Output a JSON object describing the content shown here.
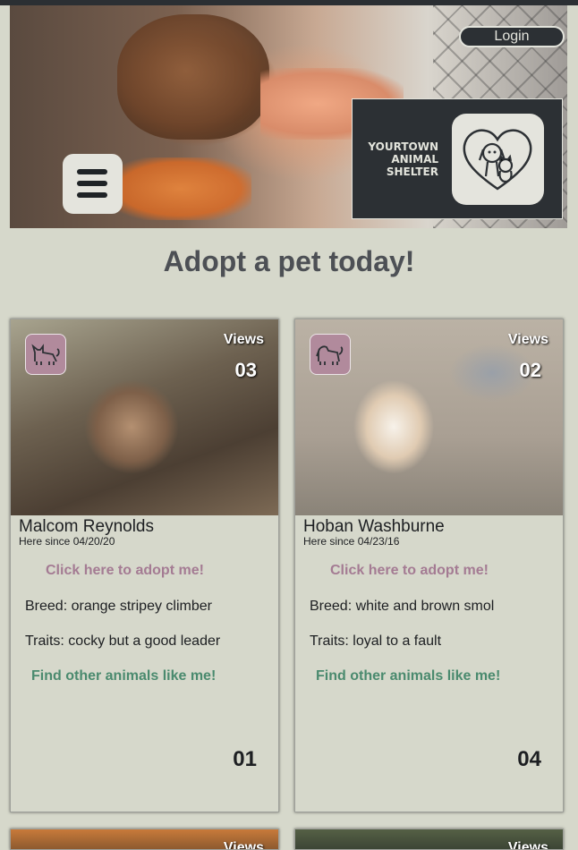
{
  "header": {
    "login_label": "Login",
    "brand_lines": [
      "YOURTOWN",
      "ANIMAL",
      "SHELTER"
    ]
  },
  "headline": "Adopt a pet today!",
  "cards": [
    {
      "icon": "cat-icon",
      "views_label": "Views",
      "views": "03",
      "name": "Malcom Reynolds",
      "since": "Here since 04/20/20",
      "adopt_label": "Click here to adopt me!",
      "breed": "Breed: orange stripey climber",
      "traits": "Traits: cocky but a good leader",
      "find_label": "Find other animals like me!",
      "number": "01"
    },
    {
      "icon": "dog-icon",
      "views_label": "Views",
      "views": "02",
      "name": "Hoban Washburne",
      "since": "Here since 04/23/16",
      "adopt_label": "Click here to adopt me!",
      "breed": "Breed: white and brown smol",
      "traits": "Traits: loyal to a fault",
      "find_label": "Find other animals like me!",
      "number": "04"
    },
    {
      "views_label": "Views"
    },
    {
      "views_label": "Views"
    }
  ],
  "colors": {
    "background": "#d6d8cb",
    "dark": "#2c3034",
    "adopt_link": "#a47b93",
    "find_link": "#4a8a6e",
    "icon_bg": "#b18a9c"
  }
}
